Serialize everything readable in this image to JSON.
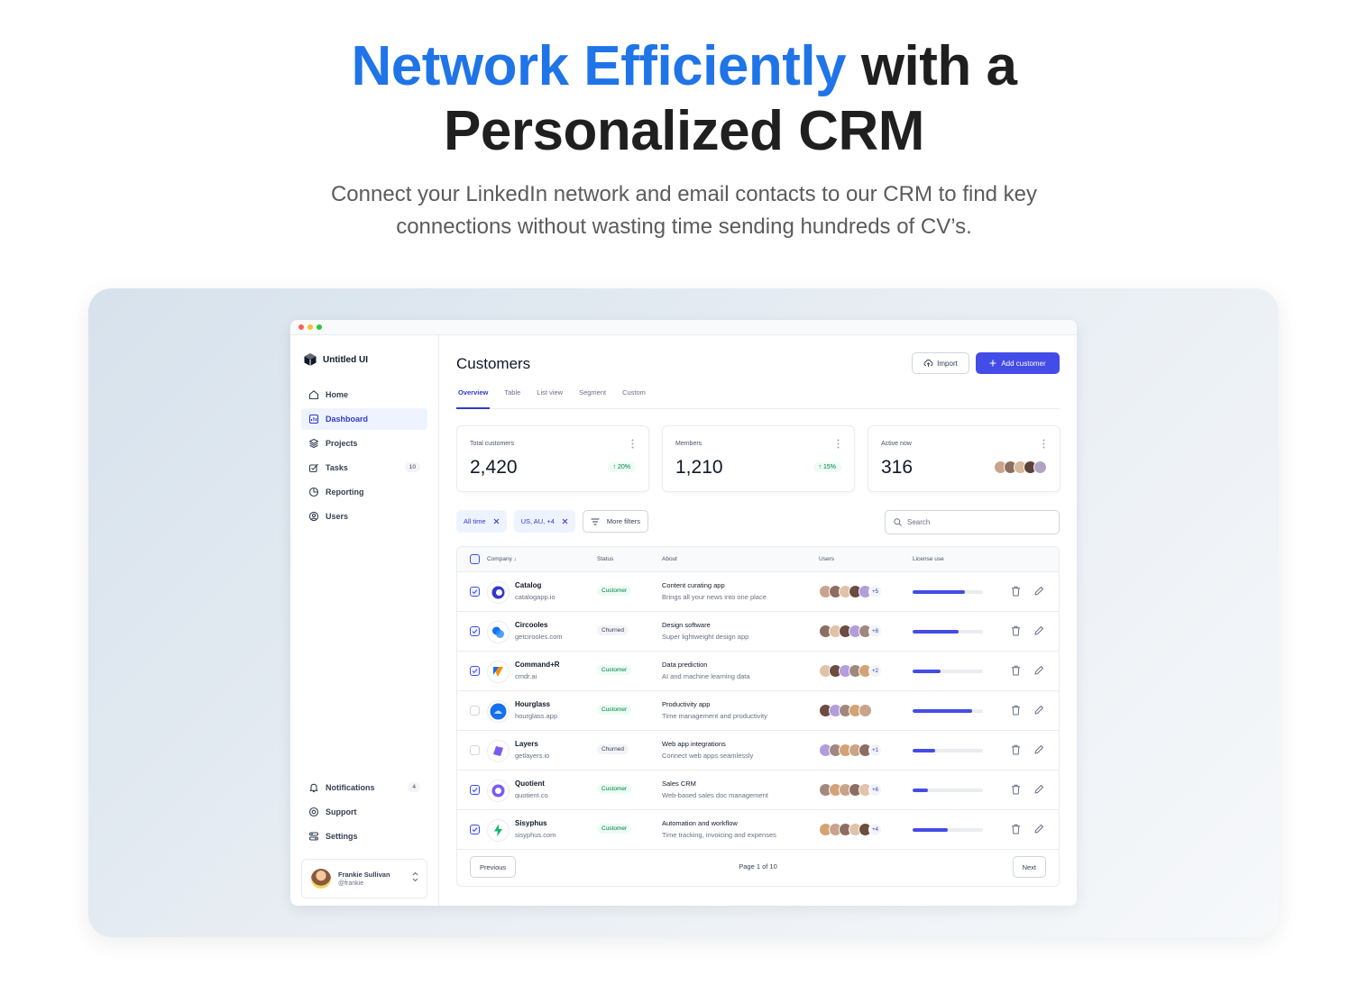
{
  "hero": {
    "title_accent": "Network Efficiently",
    "title_rest_line1": "with a",
    "title_line2": "Personalized CRM",
    "subtitle": "Connect your LinkedIn network and email contacts to our CRM to find key connections without wasting time sending hundreds of CV’s."
  },
  "sidebar": {
    "brand": "Untitled UI",
    "items": [
      {
        "label": "Home",
        "icon": "home-icon"
      },
      {
        "label": "Dashboard",
        "icon": "dashboard-icon",
        "active": true
      },
      {
        "label": "Projects",
        "icon": "layers-icon"
      },
      {
        "label": "Tasks",
        "icon": "check-square-icon",
        "badge": "10"
      },
      {
        "label": "Reporting",
        "icon": "pie-chart-icon"
      },
      {
        "label": "Users",
        "icon": "user-circle-icon"
      }
    ],
    "bottom_items": [
      {
        "label": "Notifications",
        "icon": "bell-icon",
        "badge": "4"
      },
      {
        "label": "Support",
        "icon": "life-buoy-icon"
      },
      {
        "label": "Settings",
        "icon": "settings-icon"
      }
    ],
    "user": {
      "name": "Frankie Sullivan",
      "handle": "@frankie"
    }
  },
  "header": {
    "title": "Customers",
    "import_label": "Import",
    "add_label": "Add customer",
    "accent": "#444ce7"
  },
  "tabs": [
    "Overview",
    "Table",
    "List view",
    "Segment",
    "Custom"
  ],
  "stats": [
    {
      "label": "Total customers",
      "value": "2,420",
      "delta": "20%"
    },
    {
      "label": "Members",
      "value": "1,210",
      "delta": "15%"
    },
    {
      "label": "Active now",
      "value": "316"
    }
  ],
  "filters": {
    "chips": [
      "All time",
      "US, AU, +4"
    ],
    "more": "More filters",
    "search_placeholder": "Search"
  },
  "table": {
    "columns": [
      "Company",
      "Status",
      "About",
      "Users",
      "License use"
    ],
    "rows": [
      {
        "name": "Catalog",
        "domain": "catalogapp.io",
        "status": "Customer",
        "about": "Content curating app",
        "about_sub": "Brings all your news into one place",
        "more": "+5",
        "license": 0.74,
        "checked": true,
        "logo": "catalog-logo-icon"
      },
      {
        "name": "Circooles",
        "domain": "getcirooles.com",
        "status": "Churned",
        "about": "Design software",
        "about_sub": "Super lightweight design app",
        "more": "+8",
        "license": 0.66,
        "checked": true,
        "logo": "circooles-logo-icon"
      },
      {
        "name": "Command+R",
        "domain": "cmdr.ai",
        "status": "Customer",
        "about": "Data prediction",
        "about_sub": "AI and machine learning data",
        "more": "+2",
        "license": 0.4,
        "checked": true,
        "logo": "commandr-logo-icon"
      },
      {
        "name": "Hourglass",
        "domain": "hourglass.app",
        "status": "Customer",
        "about": "Productivity app",
        "about_sub": "Time management and productivity",
        "more": "",
        "license": 0.84,
        "checked": false,
        "logo": "hourglass-logo-icon"
      },
      {
        "name": "Layers",
        "domain": "getlayers.io",
        "status": "Churned",
        "about": "Web app integrations",
        "about_sub": "Connect web apps seamlessly",
        "more": "+1",
        "license": 0.32,
        "checked": false,
        "logo": "layers-logo-icon"
      },
      {
        "name": "Quotient",
        "domain": "quotient.co",
        "status": "Customer",
        "about": "Sales CRM",
        "about_sub": "Web-based sales doc management",
        "more": "+6",
        "license": 0.22,
        "checked": true,
        "logo": "quotient-logo-icon"
      },
      {
        "name": "Sisyphus",
        "domain": "sisyphus.com",
        "status": "Customer",
        "about": "Automation and workflow",
        "about_sub": "Time tracking, invoicing and expenses",
        "more": "+4",
        "license": 0.5,
        "checked": true,
        "logo": "sisyphus-logo-icon"
      }
    ]
  },
  "pagination": {
    "previous": "Previous",
    "next": "Next",
    "info": "Page 1 of 10"
  }
}
